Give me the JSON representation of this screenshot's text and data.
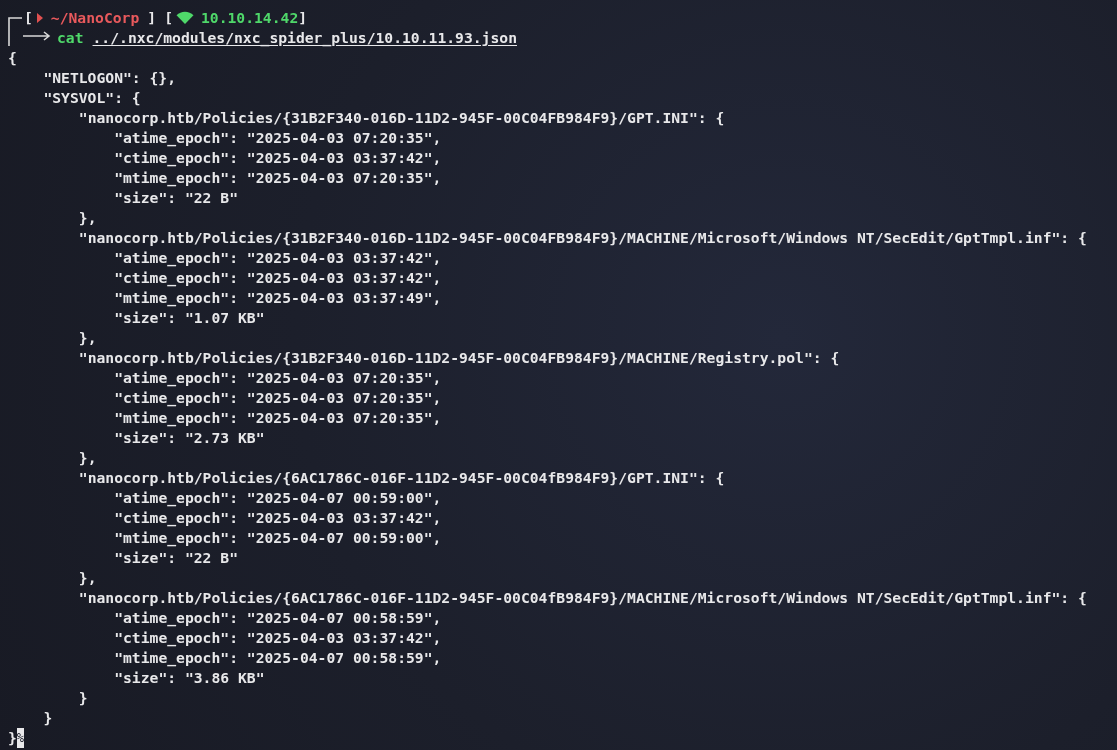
{
  "prompt": {
    "open_bracket": "[",
    "path": "~/NanoCorp",
    "close_bracket": "]",
    "ip_open_bracket": "[",
    "ip": "10.10.14.42",
    "ip_close_bracket": "]",
    "command": "cat",
    "argument": "../.nxc/modules/nxc_spider_plus/10.10.11.93.json"
  },
  "output": {
    "text": "{",
    "close": "}",
    "children": [
      {
        "text": "\"NETLOGON\": {},"
      },
      {
        "text": "\"SYSVOL\": {",
        "close": "}",
        "children": [
          {
            "text": "\"nanocorp.htb/Policies/{31B2F340-016D-11D2-945F-00C04FB984F9}/GPT.INI\": {",
            "close": "},",
            "children": [
              {
                "text": "\"atime_epoch\": \"2025-04-03 07:20:35\","
              },
              {
                "text": "\"ctime_epoch\": \"2025-04-03 03:37:42\","
              },
              {
                "text": "\"mtime_epoch\": \"2025-04-03 07:20:35\","
              },
              {
                "text": "\"size\": \"22 B\""
              }
            ]
          },
          {
            "text": "\"nanocorp.htb/Policies/{31B2F340-016D-11D2-945F-00C04FB984F9}/MACHINE/Microsoft/Windows NT/SecEdit/GptTmpl.inf\": {",
            "close": "},",
            "children": [
              {
                "text": "\"atime_epoch\": \"2025-04-03 03:37:42\","
              },
              {
                "text": "\"ctime_epoch\": \"2025-04-03 03:37:42\","
              },
              {
                "text": "\"mtime_epoch\": \"2025-04-03 03:37:49\","
              },
              {
                "text": "\"size\": \"1.07 KB\""
              }
            ]
          },
          {
            "text": "\"nanocorp.htb/Policies/{31B2F340-016D-11D2-945F-00C04FB984F9}/MACHINE/Registry.pol\": {",
            "close": "},",
            "children": [
              {
                "text": "\"atime_epoch\": \"2025-04-03 07:20:35\","
              },
              {
                "text": "\"ctime_epoch\": \"2025-04-03 07:20:35\","
              },
              {
                "text": "\"mtime_epoch\": \"2025-04-03 07:20:35\","
              },
              {
                "text": "\"size\": \"2.73 KB\""
              }
            ]
          },
          {
            "text": "\"nanocorp.htb/Policies/{6AC1786C-016F-11D2-945F-00C04fB984F9}/GPT.INI\": {",
            "close": "},",
            "children": [
              {
                "text": "\"atime_epoch\": \"2025-04-07 00:59:00\","
              },
              {
                "text": "\"ctime_epoch\": \"2025-04-03 03:37:42\","
              },
              {
                "text": "\"mtime_epoch\": \"2025-04-07 00:59:00\","
              },
              {
                "text": "\"size\": \"22 B\""
              }
            ]
          },
          {
            "text": "\"nanocorp.htb/Policies/{6AC1786C-016F-11D2-945F-00C04fB984F9}/MACHINE/Microsoft/Windows NT/SecEdit/GptTmpl.inf\": {",
            "close": "}",
            "children": [
              {
                "text": "\"atime_epoch\": \"2025-04-07 00:58:59\","
              },
              {
                "text": "\"ctime_epoch\": \"2025-04-03 03:37:42\","
              },
              {
                "text": "\"mtime_epoch\": \"2025-04-07 00:58:59\","
              },
              {
                "text": "\"size\": \"3.86 KB\""
              }
            ]
          }
        ]
      }
    ]
  },
  "end_marker": "%"
}
